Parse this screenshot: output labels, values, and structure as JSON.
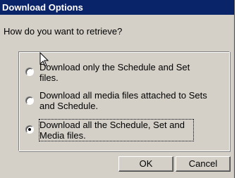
{
  "dialog": {
    "title": "Download Options",
    "prompt": "How do you want to retrieve?",
    "options": [
      {
        "label": "Download only the Schedule and Set files.",
        "selected": false
      },
      {
        "label": "Download all media files attached to Sets and Schedule.",
        "selected": false
      },
      {
        "label": "Download all the Schedule, Set and Media files.",
        "selected": true
      }
    ],
    "ok_label": "OK",
    "cancel_label": "Cancel"
  },
  "colors": {
    "title_bar": "#0a246a",
    "title_text": "#ffffff",
    "face": "#d4d0c8"
  },
  "icons": {
    "cursor": "mouse-pointer-icon"
  }
}
